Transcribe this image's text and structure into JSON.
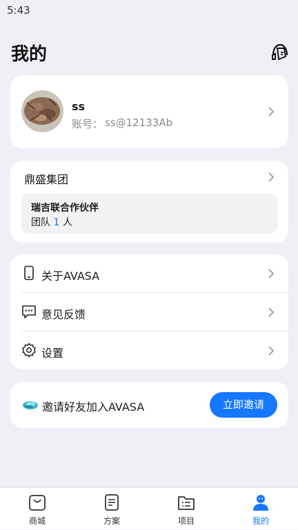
{
  "status_bar": {
    "time": "5:43"
  },
  "header": {
    "title": "我的",
    "icon": "headset-support-icon"
  },
  "profile": {
    "name": "ss",
    "account_label": "账号：",
    "account_value": "ss@12133Ab"
  },
  "organization": {
    "name": "鼎盛集团",
    "team": {
      "name": "瑞吉联合作伙伴",
      "count_prefix": "团队",
      "count": "1",
      "count_suffix": "人"
    }
  },
  "menu": {
    "items": [
      {
        "label": "关于AVASA",
        "icon": "phone-icon"
      },
      {
        "label": "意见反馈",
        "icon": "feedback-icon"
      },
      {
        "label": "设置",
        "icon": "gear-icon"
      }
    ]
  },
  "invite": {
    "text": "邀请好友加入AVASA",
    "button_label": "立即邀请",
    "icon": "avasa-logo-icon"
  },
  "tab_bar": {
    "tabs": [
      {
        "label": "商城",
        "icon": "shopping-bag-icon"
      },
      {
        "label": "方案",
        "icon": "document-icon"
      },
      {
        "label": "项目",
        "icon": "folder-list-icon"
      },
      {
        "label": "我的",
        "icon": "person-icon"
      }
    ],
    "active": "我的"
  },
  "colors": {
    "accent": "#1677ff",
    "background": "#f0eff5",
    "card": "#ffffff"
  }
}
